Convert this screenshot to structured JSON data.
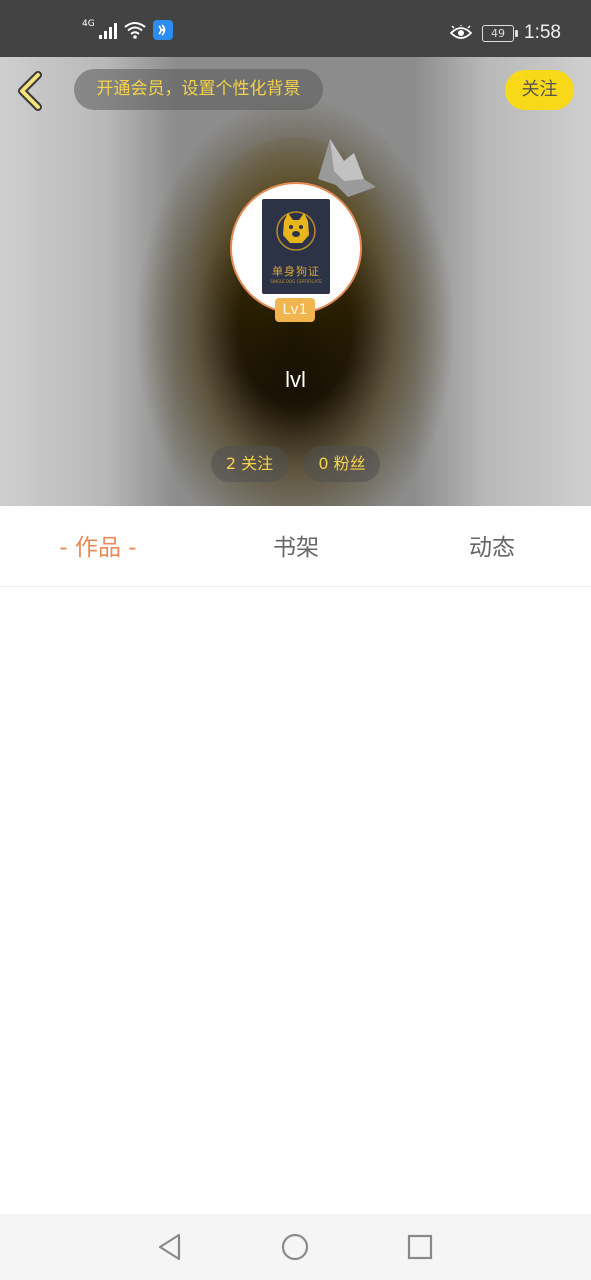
{
  "status_bar": {
    "network_label": "4G",
    "nfc_icon": "nfc-icon",
    "eye_icon": "eye-comfort-icon",
    "battery": "49",
    "time": "1:58"
  },
  "header": {
    "vip_banner": "开通会员，设置个性化背景",
    "follow_label": "关注",
    "avatar_caption": "单身狗证",
    "avatar_subcaption": "SINGLE DOG CERTIFICATE",
    "level": "Lv1",
    "username": "lvl",
    "following": "2 关注",
    "fans": "0 粉丝",
    "accent_color": "#f7d91a"
  },
  "tabs": [
    {
      "label": "- 作品 -",
      "active": true
    },
    {
      "label": "书架",
      "active": false
    },
    {
      "label": "动态",
      "active": false
    }
  ],
  "colors": {
    "active_tab": "#e98a54",
    "pill_text": "#f6d34a",
    "status_bar": "#434343"
  }
}
